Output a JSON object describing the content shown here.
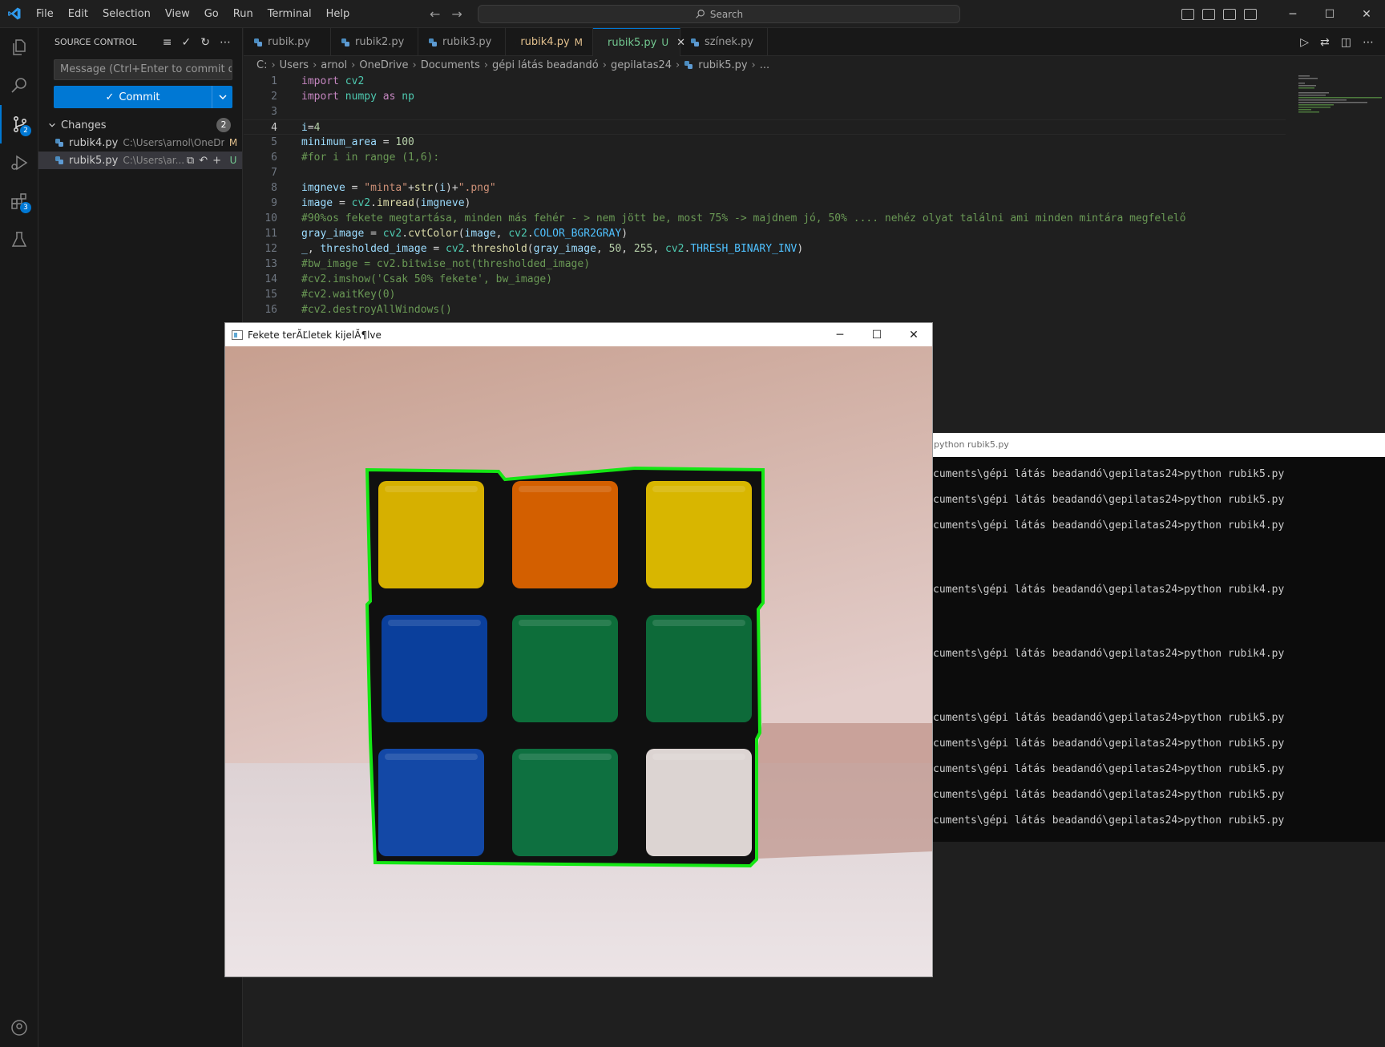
{
  "menu": [
    "File",
    "Edit",
    "Selection",
    "View",
    "Go",
    "Run",
    "Terminal",
    "Help"
  ],
  "command_center": {
    "label": "Search"
  },
  "activity_bar": {
    "scm_badge": "2",
    "extensions_badge": "3"
  },
  "sidebar": {
    "title": "SOURCE CONTROL",
    "commit_placeholder": "Message (Ctrl+Enter to commit on...",
    "commit_label": "Commit",
    "changes_label": "Changes",
    "changes_count": "2",
    "files": [
      {
        "name": "rubik4.py",
        "path": "C:\\Users\\arnol\\OneDri...",
        "status": "M",
        "status_color": "#e2c08d"
      },
      {
        "name": "rubik5.py",
        "path": "C:\\Users\\ar...",
        "status": "U",
        "status_color": "#73c991"
      }
    ]
  },
  "tabs": [
    {
      "label": "rubik.py",
      "status": "",
      "active": false
    },
    {
      "label": "rubik2.py",
      "status": "",
      "active": false
    },
    {
      "label": "rubik3.py",
      "status": "",
      "active": false
    },
    {
      "label": "rubik4.py",
      "status": "M",
      "active": false
    },
    {
      "label": "rubik5.py",
      "status": "U",
      "active": true
    },
    {
      "label": "színek.py",
      "status": "",
      "active": false
    }
  ],
  "breadcrumb": [
    "C:",
    "Users",
    "arnol",
    "OneDrive",
    "Documents",
    "gépi látás beadandó",
    "gepilatas24",
    "rubik5.py",
    "..."
  ],
  "code": {
    "current_line": 4,
    "lines": [
      [
        [
          "kw",
          "import"
        ],
        [
          "op",
          " "
        ],
        [
          "mod",
          "cv2"
        ]
      ],
      [
        [
          "kw",
          "import"
        ],
        [
          "op",
          " "
        ],
        [
          "mod",
          "numpy"
        ],
        [
          "op",
          " "
        ],
        [
          "kw",
          "as"
        ],
        [
          "op",
          " "
        ],
        [
          "mod",
          "np"
        ]
      ],
      [],
      [
        [
          "var",
          "i"
        ],
        [
          "op",
          "="
        ],
        [
          "num",
          "4"
        ]
      ],
      [
        [
          "var",
          "minimum_area"
        ],
        [
          "op",
          " = "
        ],
        [
          "num",
          "100"
        ]
      ],
      [
        [
          "cm",
          "#for i in range (1,6):"
        ]
      ],
      [],
      [
        [
          "var",
          "imgneve"
        ],
        [
          "op",
          " = "
        ],
        [
          "str",
          "\"minta\""
        ],
        [
          "op",
          "+"
        ],
        [
          "fn",
          "str"
        ],
        [
          "op",
          "("
        ],
        [
          "var",
          "i"
        ],
        [
          "op",
          ")+"
        ],
        [
          "str",
          "\".png\""
        ]
      ],
      [
        [
          "var",
          "image"
        ],
        [
          "op",
          " = "
        ],
        [
          "mod",
          "cv2"
        ],
        [
          "op",
          "."
        ],
        [
          "fn",
          "imread"
        ],
        [
          "op",
          "("
        ],
        [
          "var",
          "imgneve"
        ],
        [
          "op",
          ")"
        ]
      ],
      [
        [
          "cm",
          "#90%os fekete megtartása, minden más fehér - > nem jött be, most 75% -> majdnem jó, 50% .... nehéz olyat találni ami minden mintára megfelelő"
        ]
      ],
      [
        [
          "var",
          "gray_image"
        ],
        [
          "op",
          " = "
        ],
        [
          "mod",
          "cv2"
        ],
        [
          "op",
          "."
        ],
        [
          "fn",
          "cvtColor"
        ],
        [
          "op",
          "("
        ],
        [
          "var",
          "image"
        ],
        [
          "op",
          ", "
        ],
        [
          "mod",
          "cv2"
        ],
        [
          "op",
          "."
        ],
        [
          "const",
          "COLOR_BGR2GRAY"
        ],
        [
          "op",
          ")"
        ]
      ],
      [
        [
          "var",
          "_"
        ],
        [
          "op",
          ", "
        ],
        [
          "var",
          "thresholded_image"
        ],
        [
          "op",
          " = "
        ],
        [
          "mod",
          "cv2"
        ],
        [
          "op",
          "."
        ],
        [
          "fn",
          "threshold"
        ],
        [
          "op",
          "("
        ],
        [
          "var",
          "gray_image"
        ],
        [
          "op",
          ", "
        ],
        [
          "num",
          "50"
        ],
        [
          "op",
          ", "
        ],
        [
          "num",
          "255"
        ],
        [
          "op",
          ", "
        ],
        [
          "mod",
          "cv2"
        ],
        [
          "op",
          "."
        ],
        [
          "const",
          "THRESH_BINARY_INV"
        ],
        [
          "op",
          ")"
        ]
      ],
      [
        [
          "cm",
          "#bw_image = cv2.bitwise_not(thresholded_image)"
        ]
      ],
      [
        [
          "cm",
          "#cv2.imshow('Csak 50% fekete', bw_image)"
        ]
      ],
      [
        [
          "cm",
          "#cv2.waitKey(0)"
        ]
      ],
      [
        [
          "cm",
          "#cv2.destroyAllWindows()"
        ]
      ]
    ]
  },
  "image_window": {
    "title": "Fekete terĂĽletek kijelĂ¶lve"
  },
  "cube_colors": {
    "tiles": [
      "#d6b000",
      "#d35f00",
      "#d8b600",
      "#0a3f9c",
      "#0d6e3a",
      "#0d6a39",
      "#1348a6",
      "#0e7040",
      "#dcd4d2"
    ],
    "contour": "#14e614",
    "body": "#101010"
  },
  "terminal": {
    "title": "python  rubik5.py",
    "lines": [
      "cuments\\gépi látás beadandó\\gepilatas24>python rubik5.py",
      "cuments\\gépi látás beadandó\\gepilatas24>python rubik5.py",
      "cuments\\gépi látás beadandó\\gepilatas24>python rubik4.py",
      "cuments\\gépi látás beadandó\\gepilatas24>python rubik4.py",
      "cuments\\gépi látás beadandó\\gepilatas24>python rubik4.py",
      "cuments\\gépi látás beadandó\\gepilatas24>python rubik5.py",
      "cuments\\gépi látás beadandó\\gepilatas24>python rubik5.py",
      "cuments\\gépi látás beadandó\\gepilatas24>python rubik5.py",
      "cuments\\gépi látás beadandó\\gepilatas24>python rubik5.py",
      "cuments\\gépi látás beadandó\\gepilatas24>python rubik5.py"
    ]
  }
}
